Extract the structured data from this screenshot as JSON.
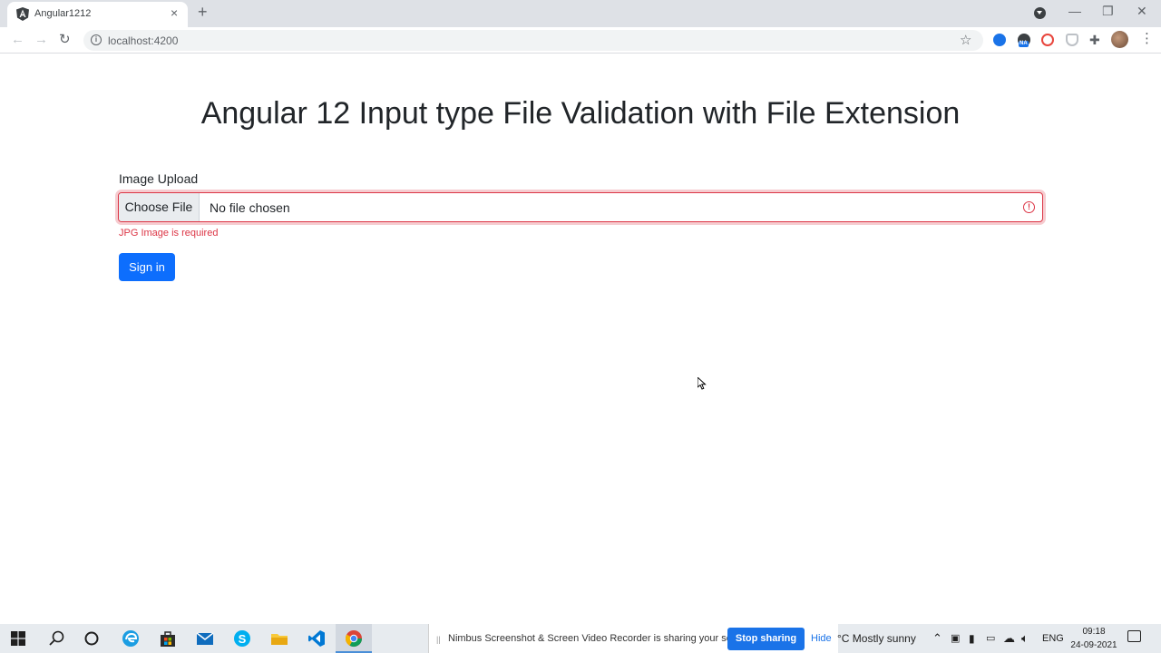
{
  "browser": {
    "tab_title": "Angular1212",
    "tab_close": "×",
    "new_tab": "+",
    "url": "localhost:4200",
    "controls": {
      "minimize": "—",
      "restore": "❐",
      "close": "✕"
    }
  },
  "page": {
    "heading": "Angular 12 Input type File Validation with File Extension",
    "field_label": "Image Upload",
    "file_button": "Choose File",
    "file_status": "No file chosen",
    "error_message": "JPG Image is required",
    "submit_label": "Sign in",
    "error_color": "#dc3545",
    "primary_color": "#0d6efd"
  },
  "taskbar": {
    "share_message": "Nimbus Screenshot & Screen Video Recorder is sharing your screen.",
    "stop_sharing": "Stop sharing",
    "hide": "Hide",
    "weather": "°C  Mostly sunny",
    "language": "ENG",
    "time": "09:18",
    "date": "24-09-2021"
  }
}
